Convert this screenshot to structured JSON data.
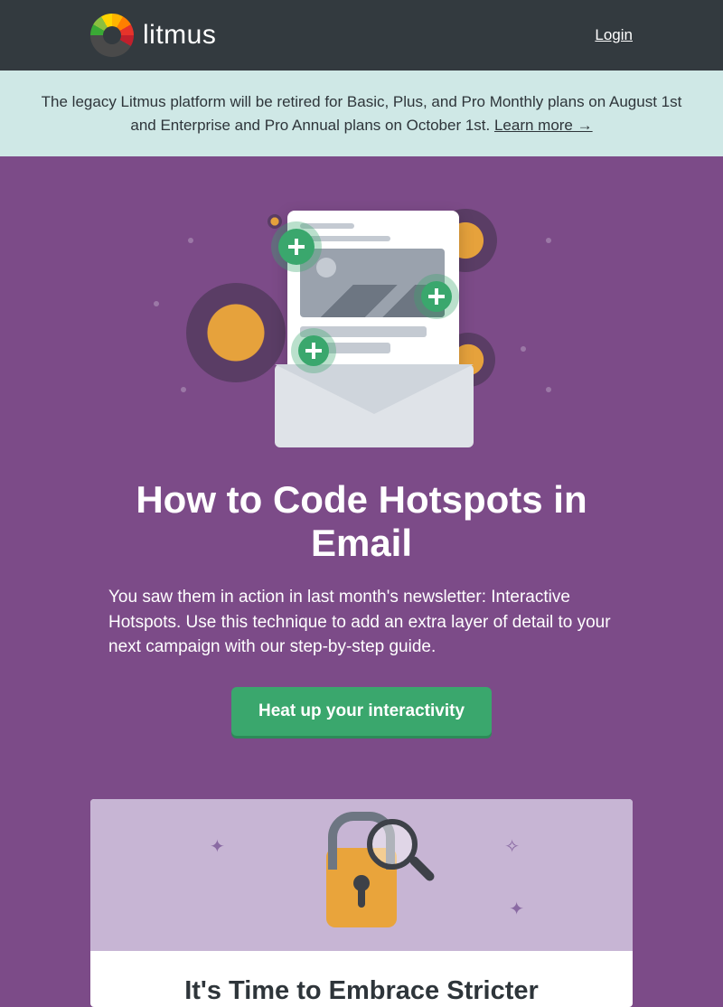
{
  "header": {
    "brand": "litmus",
    "login": "Login"
  },
  "banner": {
    "text": "The legacy Litmus platform will be retired for Basic, Plus, and Pro Monthly plans on August 1st and Enterprise and Pro Annual plans on October 1st. ",
    "link": "Learn more →"
  },
  "hero": {
    "title": "How to Code Hotspots in Email",
    "body": "You saw them in action in last month's newsletter: Interactive Hotspots. Use this technique to add an extra layer of detail to your next campaign with our step-by-step guide.",
    "cta": "Heat up your interactivity"
  },
  "card": {
    "title": "It's Time to Embrace Stricter"
  }
}
